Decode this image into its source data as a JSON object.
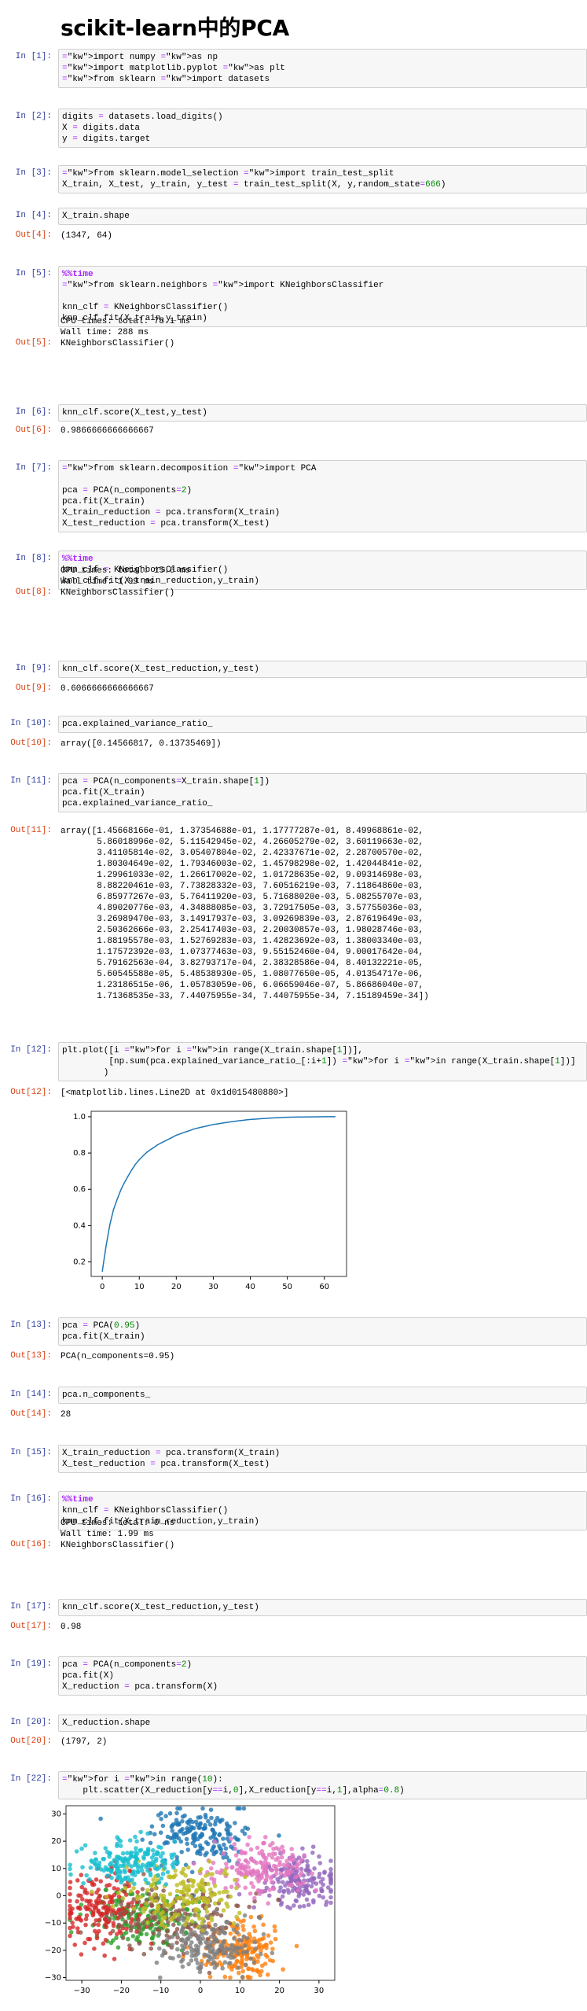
{
  "title": "scikit-learn中的PCA",
  "cells": [
    {
      "id": "c1",
      "in": "In [1]:",
      "code": [
        "import numpy as np",
        "import matplotlib.pyplot as plt",
        "from sklearn import datasets"
      ]
    },
    {
      "id": "c2",
      "in": "In [2]:",
      "code": [
        "digits = datasets.load_digits()",
        "X = digits.data",
        "y = digits.target"
      ]
    },
    {
      "id": "c3",
      "in": "In [3]:",
      "code": [
        "from sklearn.model_selection import train_test_split",
        "X_train, X_test, y_train, y_test = train_test_split(X, y,random_state=666)"
      ]
    },
    {
      "id": "c4",
      "in": "In [4]:",
      "code": [
        "X_train.shape"
      ],
      "outp": "Out[4]:",
      "out": [
        "(1347, 64)"
      ]
    },
    {
      "id": "c5",
      "in": "In [5]:",
      "code": [
        "%%time",
        "from sklearn.neighbors import KNeighborsClassifier",
        "",
        "knn_clf = KNeighborsClassifier()",
        "knn_clf.fit(X_train,y_train)"
      ],
      "stream": [
        "CPU times: total: 78.1 ms",
        "Wall time: 288 ms"
      ],
      "outp": "Out[5]:",
      "out": [
        "KNeighborsClassifier()"
      ]
    },
    {
      "id": "c6",
      "in": "In [6]:",
      "code": [
        "knn_clf.score(X_test,y_test)"
      ],
      "outp": "Out[6]:",
      "out": [
        "0.9866666666666667"
      ]
    },
    {
      "id": "c7",
      "in": "In [7]:",
      "code": [
        "from sklearn.decomposition import PCA",
        "",
        "pca = PCA(n_components=2)",
        "pca.fit(X_train)",
        "X_train_reduction = pca.transform(X_train)",
        "X_test_reduction = pca.transform(X_test)"
      ]
    },
    {
      "id": "c8",
      "in": "In [8]:",
      "code": [
        "%%time",
        "knn_clf = KNeighborsClassifier()",
        "knn_clf.fit(X_train_reduction,y_train)"
      ],
      "stream": [
        "CPU times: total: 15.6 ms",
        "Wall time: 1.99 ms"
      ],
      "outp": "Out[8]:",
      "out": [
        "KNeighborsClassifier()"
      ]
    },
    {
      "id": "c9",
      "in": "In [9]:",
      "code": [
        "knn_clf.score(X_test_reduction,y_test)"
      ],
      "outp": "Out[9]:",
      "out": [
        "0.6066666666666667"
      ]
    },
    {
      "id": "c10",
      "in": "In [10]:",
      "code": [
        "pca.explained_variance_ratio_"
      ],
      "outp": "Out[10]:",
      "out": [
        "array([0.14566817, 0.13735469])"
      ]
    },
    {
      "id": "c11",
      "in": "In [11]:",
      "code": [
        "pca = PCA(n_components=X_train.shape[1])",
        "pca.fit(X_train)",
        "pca.explained_variance_ratio_"
      ],
      "outp": "Out[11]:",
      "out": [
        "array([1.45668166e-01, 1.37354688e-01, 1.17777287e-01, 8.49968861e-02,",
        "       5.86018996e-02, 5.11542945e-02, 4.26605279e-02, 3.60119663e-02,",
        "       3.41105814e-02, 3.05407804e-02, 2.42337671e-02, 2.28700570e-02,",
        "       1.80304649e-02, 1.79346003e-02, 1.45798298e-02, 1.42044841e-02,",
        "       1.29961033e-02, 1.26617002e-02, 1.01728635e-02, 9.09314698e-03,",
        "       8.88220461e-03, 7.73828332e-03, 7.60516219e-03, 7.11864860e-03,",
        "       6.85977267e-03, 5.76411920e-03, 5.71688020e-03, 5.08255707e-03,",
        "       4.89020776e-03, 4.34888085e-03, 3.72917505e-03, 3.57755036e-03,",
        "       3.26989470e-03, 3.14917937e-03, 3.09269839e-03, 2.87619649e-03,",
        "       2.50362666e-03, 2.25417403e-03, 2.20030857e-03, 1.98028746e-03,",
        "       1.88195578e-03, 1.52769283e-03, 1.42823692e-03, 1.38003340e-03,",
        "       1.17572392e-03, 1.07377463e-03, 9.55152460e-04, 9.00017642e-04,",
        "       5.79162563e-04, 3.82793717e-04, 2.38328586e-04, 8.40132221e-05,",
        "       5.60545588e-05, 5.48538930e-05, 1.08077650e-05, 4.01354717e-06,",
        "       1.23186515e-06, 1.05783059e-06, 6.06659046e-07, 5.86686040e-07,",
        "       1.71368535e-33, 7.44075955e-34, 7.44075955e-34, 7.15189459e-34])"
      ]
    },
    {
      "id": "c12",
      "in": "In [12]:",
      "code": [
        "plt.plot([i for i in range(X_train.shape[1])],",
        "         [np.sum(pca.explained_variance_ratio_[:i+1]) for i in range(X_train.shape[1])]",
        "        )"
      ],
      "outp": "Out[12]:",
      "out": [
        "[<matplotlib.lines.Line2D at 0x1d015480880>]"
      ]
    },
    {
      "id": "c13",
      "in": "In [13]:",
      "code": [
        "pca = PCA(0.95)",
        "pca.fit(X_train)"
      ],
      "outp": "Out[13]:",
      "out": [
        "PCA(n_components=0.95)"
      ]
    },
    {
      "id": "c14",
      "in": "In [14]:",
      "code": [
        "pca.n_components_"
      ],
      "outp": "Out[14]:",
      "out": [
        "28"
      ]
    },
    {
      "id": "c15",
      "in": "In [15]:",
      "code": [
        "X_train_reduction = pca.transform(X_train)",
        "X_test_reduction = pca.transform(X_test)"
      ]
    },
    {
      "id": "c16",
      "in": "In [16]:",
      "code": [
        "%%time",
        "knn_clf = KNeighborsClassifier()",
        "knn_clf.fit(X_train_reduction,y_train)"
      ],
      "stream": [
        "CPU times: total: 0 ns",
        "Wall time: 1.99 ms"
      ],
      "outp": "Out[16]:",
      "out": [
        "KNeighborsClassifier()"
      ]
    },
    {
      "id": "c17",
      "in": "In [17]:",
      "code": [
        "knn_clf.score(X_test_reduction,y_test)"
      ],
      "outp": "Out[17]:",
      "out": [
        "0.98"
      ]
    },
    {
      "id": "c19",
      "in": "In [19]:",
      "code": [
        "pca = PCA(n_components=2)",
        "pca.fit(X)",
        "X_reduction = pca.transform(X)"
      ]
    },
    {
      "id": "c20",
      "in": "In [20]:",
      "code": [
        "X_reduction.shape"
      ],
      "outp": "Out[20]:",
      "out": [
        "(1797, 2)"
      ]
    },
    {
      "id": "c22",
      "in": "In [22]:",
      "code": [
        "for i in range(10):",
        "    plt.scatter(X_reduction[y==i,0],X_reduction[y==i,1],alpha=0.8)"
      ]
    }
  ],
  "chart_data": [
    {
      "type": "line",
      "x": [
        0,
        1,
        2,
        3,
        4,
        5,
        6,
        7,
        8,
        9,
        10,
        12,
        15,
        20,
        25,
        30,
        35,
        40,
        45,
        50,
        55,
        60,
        63
      ],
      "y": [
        0.146,
        0.283,
        0.401,
        0.486,
        0.544,
        0.596,
        0.638,
        0.674,
        0.708,
        0.739,
        0.763,
        0.804,
        0.846,
        0.898,
        0.934,
        0.957,
        0.973,
        0.985,
        0.992,
        0.997,
        0.999,
        1.0,
        1.0
      ],
      "xticks": [
        "0",
        "10",
        "20",
        "30",
        "40",
        "50",
        "60"
      ],
      "yticks": [
        "0.2",
        "0.4",
        "0.6",
        "0.8",
        "1.0"
      ],
      "xlim": [
        -3,
        66
      ],
      "ylim": [
        0.12,
        1.03
      ],
      "color": "#1f77b4"
    },
    {
      "type": "scatter",
      "xticks": [
        "−30",
        "−20",
        "−10",
        "0",
        "10",
        "20",
        "30"
      ],
      "yticks": [
        "30",
        "20",
        "10",
        "0",
        "−10",
        "−20",
        "−30"
      ],
      "xlim": [
        -34,
        34
      ],
      "ylim": [
        -31,
        33
      ],
      "series": [
        {
          "color": "#1f77b4",
          "cx": 0,
          "cy": 22,
          "sx": 6,
          "sy": 5,
          "n": 180
        },
        {
          "color": "#ff7f0e",
          "cx": 10,
          "cy": -20,
          "sx": 5,
          "sy": 5,
          "n": 180
        },
        {
          "color": "#2ca02c",
          "cx": -15,
          "cy": -8,
          "sx": 6,
          "sy": 5,
          "n": 180
        },
        {
          "color": "#d62728",
          "cx": -25,
          "cy": -4,
          "sx": 5,
          "sy": 7,
          "n": 180
        },
        {
          "color": "#9467bd",
          "cx": 25,
          "cy": 5,
          "sx": 5,
          "sy": 5,
          "n": 180
        },
        {
          "color": "#8c564b",
          "cx": -5,
          "cy": -8,
          "sx": 8,
          "sy": 6,
          "n": 180
        },
        {
          "color": "#e377c2",
          "cx": 15,
          "cy": 10,
          "sx": 6,
          "sy": 5,
          "n": 180
        },
        {
          "color": "#7f7f7f",
          "cx": 2,
          "cy": -18,
          "sx": 6,
          "sy": 5,
          "n": 180
        },
        {
          "color": "#bcbd22",
          "cx": -5,
          "cy": 0,
          "sx": 7,
          "sy": 6,
          "n": 180
        },
        {
          "color": "#17becf",
          "cx": -18,
          "cy": 12,
          "sx": 6,
          "sy": 4,
          "n": 180
        }
      ]
    }
  ]
}
